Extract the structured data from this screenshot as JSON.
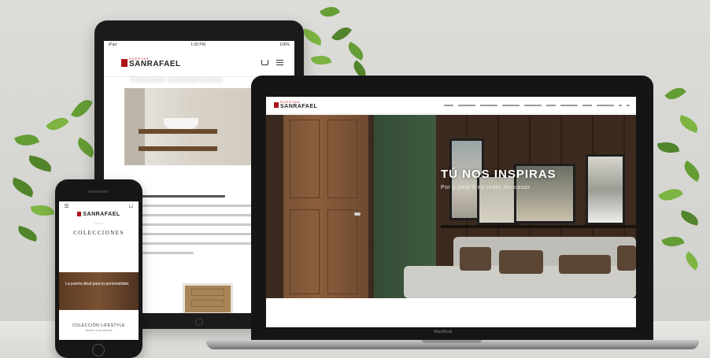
{
  "tablet": {
    "status_left": "iPad",
    "status_time": "1:00 PM",
    "status_right": "100%",
    "brand_small": "PUERTAS",
    "brand_name": "SANRAFAEL",
    "hero_text": "Colección contemporánea"
  },
  "laptop": {
    "brand_small": "PUERTAS",
    "brand_name": "SANRAFAEL",
    "hero_title": "TÚ NOS INSPIRAS",
    "hero_subtitle": "Por y para ti en todas las casas",
    "device_label": "MacBook"
  },
  "phone": {
    "brand_name": "SANRAFAEL",
    "ornament": "~~~",
    "section_title": "COLECCIONES",
    "hero_text": "La puerta ideal para tu personalidad",
    "card_title": "COLECCIÓN LIFESTYLE",
    "card_subtitle": "Diseño y tendencia"
  },
  "colors": {
    "brand_red": "#b0121b",
    "accent_green": "#3f5a3f",
    "wood": "#8b5e3c"
  }
}
